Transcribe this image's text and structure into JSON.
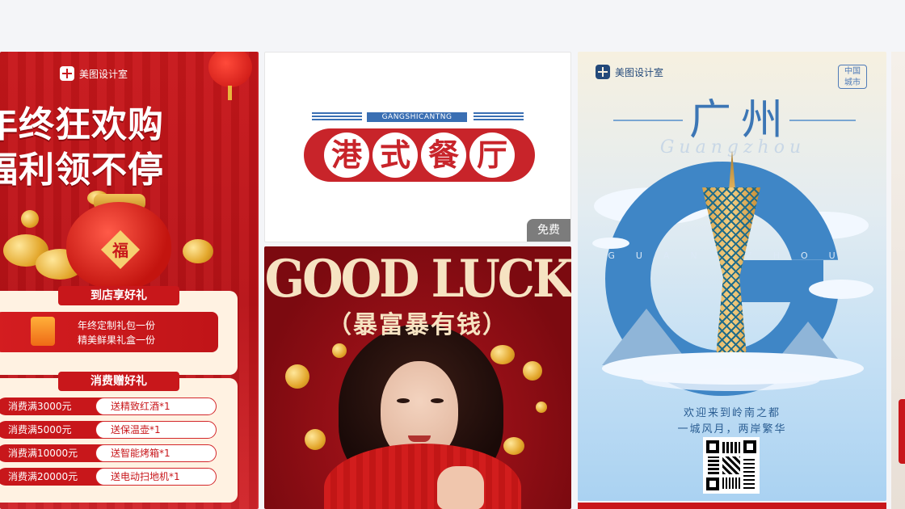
{
  "cards": {
    "promo": {
      "brand": "美图设计室",
      "headline_line1": "年终狂欢购",
      "headline_line2": "福利领不停",
      "bag_char": "福",
      "section1_title": "到店享好礼",
      "gift_line1": "年终定制礼包一份",
      "gift_line2": "精美鲜果礼盒一份",
      "section2_title": "消费赠好礼",
      "tiers": [
        {
          "spend": "消费满3000元",
          "reward": "送精致红酒*1"
        },
        {
          "spend": "消费满5000元",
          "reward": "送保温壶*1"
        },
        {
          "spend": "消费满10000元",
          "reward": "送智能烤箱*1"
        },
        {
          "spend": "消费满20000元",
          "reward": "送电动扫地机*1"
        }
      ]
    },
    "restaurant": {
      "en_name": "GANGSHICANTNG",
      "chars": [
        "港",
        "式",
        "餐",
        "厅"
      ],
      "badge": "免费"
    },
    "goodluck": {
      "title": "GOOD LUCK",
      "subtitle": "（暴富暴有钱）"
    },
    "guangzhou": {
      "brand": "美图设计室",
      "stamp_line1": "中国",
      "stamp_line2": "城市",
      "title": "广州",
      "script": "Guangzhou",
      "spaced": "GUANGZHOU",
      "caption1": "欢迎来到岭南之都",
      "caption2": "一城风月，两岸繁华"
    }
  },
  "colors": {
    "promo_red": "#c8171b",
    "restaurant_red": "#c8242a",
    "restaurant_blue": "#3a6fb3",
    "gz_blue": "#3f86c6",
    "gold": "#e3a72c"
  }
}
